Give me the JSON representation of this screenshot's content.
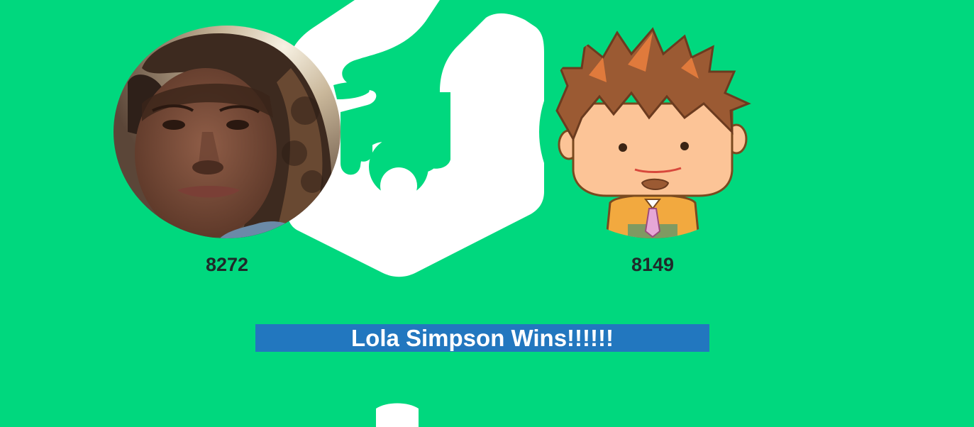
{
  "players": [
    {
      "name": "Lola Simpson",
      "avatar_icon": "photo-avatar",
      "score": "8272"
    },
    {
      "avatar_icon": "cartoon-boy-avatar",
      "score": "8149"
    }
  ],
  "result": {
    "banner_text": "Lola Simpson Wins!!!!!!"
  },
  "colors": {
    "background": "#00d87e",
    "banner": "#2277bf",
    "banner_text": "#ffffff",
    "score_text": "#1f2a2a",
    "logo": "#ffffff"
  }
}
